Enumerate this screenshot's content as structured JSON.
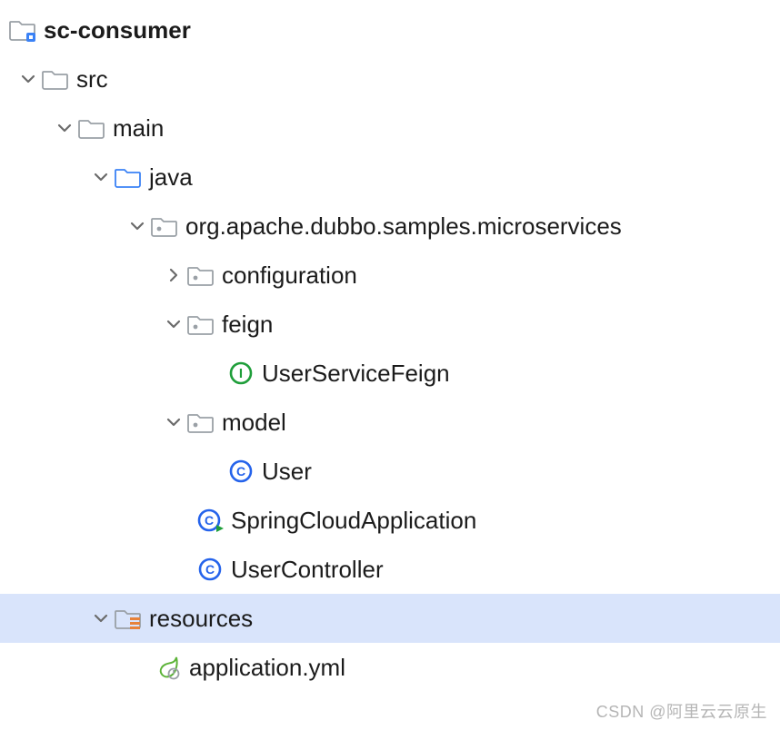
{
  "tree": {
    "root": {
      "label": "sc-consumer",
      "icon": "module-folder",
      "bold": true,
      "indent": 10,
      "arrow": "none"
    },
    "nodes": [
      {
        "label": "src",
        "icon": "folder",
        "indent": 50,
        "arrow": "down"
      },
      {
        "label": "main",
        "icon": "folder",
        "indent": 90,
        "arrow": "down"
      },
      {
        "label": "java",
        "icon": "source-folder",
        "indent": 130,
        "arrow": "down"
      },
      {
        "label": "org.apache.dubbo.samples.microservices",
        "icon": "package",
        "indent": 170,
        "arrow": "down"
      },
      {
        "label": "configuration",
        "icon": "package",
        "indent": 210,
        "arrow": "right"
      },
      {
        "label": "feign",
        "icon": "package",
        "indent": 210,
        "arrow": "down"
      },
      {
        "label": "UserServiceFeign",
        "icon": "interface",
        "indent": 280,
        "arrow": "none"
      },
      {
        "label": "model",
        "icon": "package",
        "indent": 210,
        "arrow": "down"
      },
      {
        "label": "User",
        "icon": "class",
        "indent": 280,
        "arrow": "none"
      },
      {
        "label": "SpringCloudApplication",
        "icon": "class-run",
        "indent": 240,
        "arrow": "none"
      },
      {
        "label": "UserController",
        "icon": "class",
        "indent": 240,
        "arrow": "none"
      },
      {
        "label": "resources",
        "icon": "resources-folder",
        "indent": 130,
        "arrow": "down",
        "selected": true
      },
      {
        "label": "application.yml",
        "icon": "spring-file",
        "indent": 200,
        "arrow": "none"
      }
    ]
  },
  "watermark": "CSDN @阿里云云原生"
}
